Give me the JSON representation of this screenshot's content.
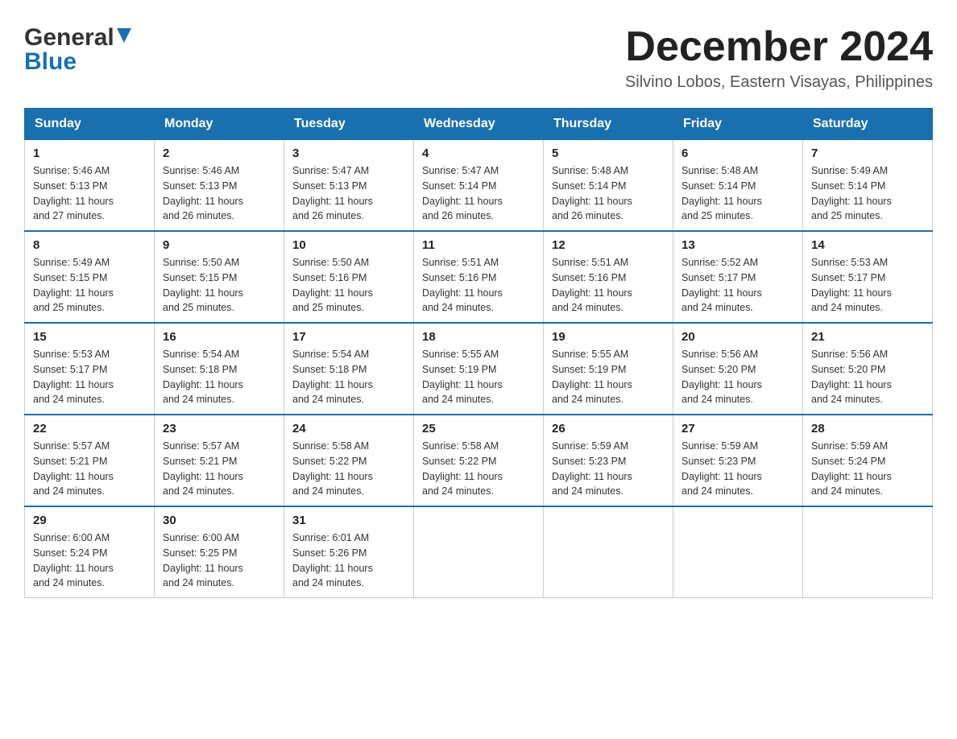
{
  "header": {
    "title": "December 2024",
    "location": "Silvino Lobos, Eastern Visayas, Philippines",
    "logo_general": "General",
    "logo_blue": "Blue"
  },
  "weekdays": [
    "Sunday",
    "Monday",
    "Tuesday",
    "Wednesday",
    "Thursday",
    "Friday",
    "Saturday"
  ],
  "weeks": [
    [
      {
        "day": "1",
        "sunrise": "5:46 AM",
        "sunset": "5:13 PM",
        "daylight": "11 hours and 27 minutes."
      },
      {
        "day": "2",
        "sunrise": "5:46 AM",
        "sunset": "5:13 PM",
        "daylight": "11 hours and 26 minutes."
      },
      {
        "day": "3",
        "sunrise": "5:47 AM",
        "sunset": "5:13 PM",
        "daylight": "11 hours and 26 minutes."
      },
      {
        "day": "4",
        "sunrise": "5:47 AM",
        "sunset": "5:14 PM",
        "daylight": "11 hours and 26 minutes."
      },
      {
        "day": "5",
        "sunrise": "5:48 AM",
        "sunset": "5:14 PM",
        "daylight": "11 hours and 26 minutes."
      },
      {
        "day": "6",
        "sunrise": "5:48 AM",
        "sunset": "5:14 PM",
        "daylight": "11 hours and 25 minutes."
      },
      {
        "day": "7",
        "sunrise": "5:49 AM",
        "sunset": "5:14 PM",
        "daylight": "11 hours and 25 minutes."
      }
    ],
    [
      {
        "day": "8",
        "sunrise": "5:49 AM",
        "sunset": "5:15 PM",
        "daylight": "11 hours and 25 minutes."
      },
      {
        "day": "9",
        "sunrise": "5:50 AM",
        "sunset": "5:15 PM",
        "daylight": "11 hours and 25 minutes."
      },
      {
        "day": "10",
        "sunrise": "5:50 AM",
        "sunset": "5:16 PM",
        "daylight": "11 hours and 25 minutes."
      },
      {
        "day": "11",
        "sunrise": "5:51 AM",
        "sunset": "5:16 PM",
        "daylight": "11 hours and 24 minutes."
      },
      {
        "day": "12",
        "sunrise": "5:51 AM",
        "sunset": "5:16 PM",
        "daylight": "11 hours and 24 minutes."
      },
      {
        "day": "13",
        "sunrise": "5:52 AM",
        "sunset": "5:17 PM",
        "daylight": "11 hours and 24 minutes."
      },
      {
        "day": "14",
        "sunrise": "5:53 AM",
        "sunset": "5:17 PM",
        "daylight": "11 hours and 24 minutes."
      }
    ],
    [
      {
        "day": "15",
        "sunrise": "5:53 AM",
        "sunset": "5:17 PM",
        "daylight": "11 hours and 24 minutes."
      },
      {
        "day": "16",
        "sunrise": "5:54 AM",
        "sunset": "5:18 PM",
        "daylight": "11 hours and 24 minutes."
      },
      {
        "day": "17",
        "sunrise": "5:54 AM",
        "sunset": "5:18 PM",
        "daylight": "11 hours and 24 minutes."
      },
      {
        "day": "18",
        "sunrise": "5:55 AM",
        "sunset": "5:19 PM",
        "daylight": "11 hours and 24 minutes."
      },
      {
        "day": "19",
        "sunrise": "5:55 AM",
        "sunset": "5:19 PM",
        "daylight": "11 hours and 24 minutes."
      },
      {
        "day": "20",
        "sunrise": "5:56 AM",
        "sunset": "5:20 PM",
        "daylight": "11 hours and 24 minutes."
      },
      {
        "day": "21",
        "sunrise": "5:56 AM",
        "sunset": "5:20 PM",
        "daylight": "11 hours and 24 minutes."
      }
    ],
    [
      {
        "day": "22",
        "sunrise": "5:57 AM",
        "sunset": "5:21 PM",
        "daylight": "11 hours and 24 minutes."
      },
      {
        "day": "23",
        "sunrise": "5:57 AM",
        "sunset": "5:21 PM",
        "daylight": "11 hours and 24 minutes."
      },
      {
        "day": "24",
        "sunrise": "5:58 AM",
        "sunset": "5:22 PM",
        "daylight": "11 hours and 24 minutes."
      },
      {
        "day": "25",
        "sunrise": "5:58 AM",
        "sunset": "5:22 PM",
        "daylight": "11 hours and 24 minutes."
      },
      {
        "day": "26",
        "sunrise": "5:59 AM",
        "sunset": "5:23 PM",
        "daylight": "11 hours and 24 minutes."
      },
      {
        "day": "27",
        "sunrise": "5:59 AM",
        "sunset": "5:23 PM",
        "daylight": "11 hours and 24 minutes."
      },
      {
        "day": "28",
        "sunrise": "5:59 AM",
        "sunset": "5:24 PM",
        "daylight": "11 hours and 24 minutes."
      }
    ],
    [
      {
        "day": "29",
        "sunrise": "6:00 AM",
        "sunset": "5:24 PM",
        "daylight": "11 hours and 24 minutes."
      },
      {
        "day": "30",
        "sunrise": "6:00 AM",
        "sunset": "5:25 PM",
        "daylight": "11 hours and 24 minutes."
      },
      {
        "day": "31",
        "sunrise": "6:01 AM",
        "sunset": "5:26 PM",
        "daylight": "11 hours and 24 minutes."
      },
      null,
      null,
      null,
      null
    ]
  ],
  "labels": {
    "sunrise": "Sunrise:",
    "sunset": "Sunset:",
    "daylight": "Daylight:"
  }
}
